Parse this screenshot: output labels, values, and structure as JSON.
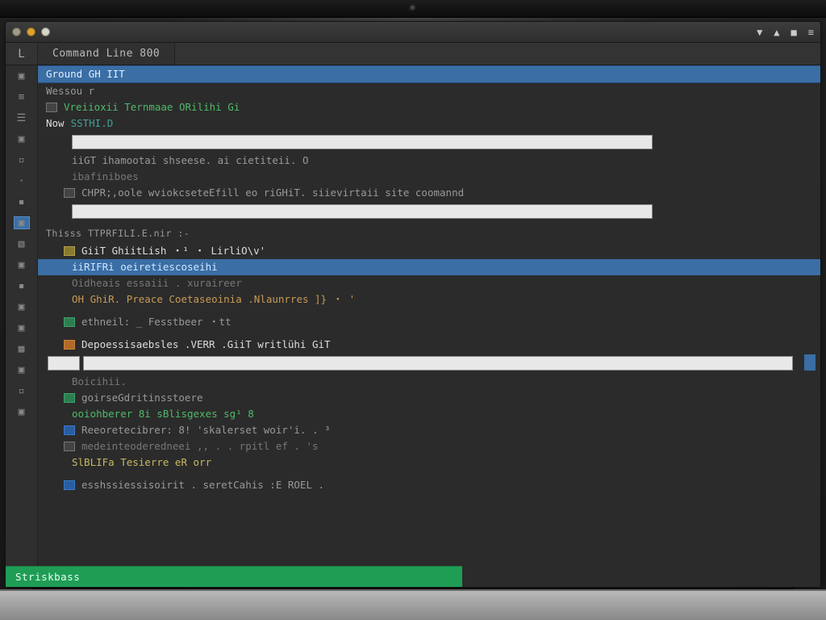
{
  "window": {
    "tab_title": "Command Line 800"
  },
  "titlebar_icons": [
    "▼",
    "▲",
    "■",
    "≡"
  ],
  "sidebar_icons": [
    "▣",
    "≡",
    "☰",
    "▣",
    "▫",
    "·",
    "▪",
    "▣",
    "▧",
    "▣",
    "▪",
    "▣",
    "▣",
    "▦",
    "▣",
    "▫",
    "▣"
  ],
  "lines": {
    "l0": "Ground GH IIT",
    "l1": "Wessou r",
    "l2": "Vreiioxii Ternmaae ORilihi Gi",
    "l3_prefix": "Now",
    "l3_cmd": "SSTHI.D",
    "l4": "iiGT ihamootai shseese. ai cietiteii. O",
    "l5": "ibafiniboes",
    "l6": "CHPR;,oole wviokcseteEfill eo riGHiT. siievirtaii site coomannd",
    "l7_label": "Thisss TTPRFILI.E.nir :-",
    "l8": "GiiT GhiitLish ・¹ ・ LirliO\\v'",
    "l9": "iiRIFRi oeiretiescoseihi",
    "l10a": "Oidheais essaiii .   xuraireer",
    "l10b": "OH GhiR. Preace Coetaseoinia .Nlaunrres ]} ・ '",
    "l11": "ethneil: _ Fesstbeer ・tt",
    "l12": "Depoessisaebsles .VERR .GiiT writlühi GiT",
    "l13": "Boicihii.",
    "l14": "goirseGdritinsstoere",
    "l15": "ooiohberer    8i   sBlisgexes sg¹  8",
    "l16": "Reeoretecibrer:    8!    'skalerset    woir'i. . ³",
    "l17": "medeinteoderedneei  ,, . . rpitl ef . 's",
    "l18": "SlBLIFa Tesierre eR orr",
    "l19": "esshssiessisoirit . seretCahis :E ROEL   ."
  },
  "status": "Striskbass"
}
